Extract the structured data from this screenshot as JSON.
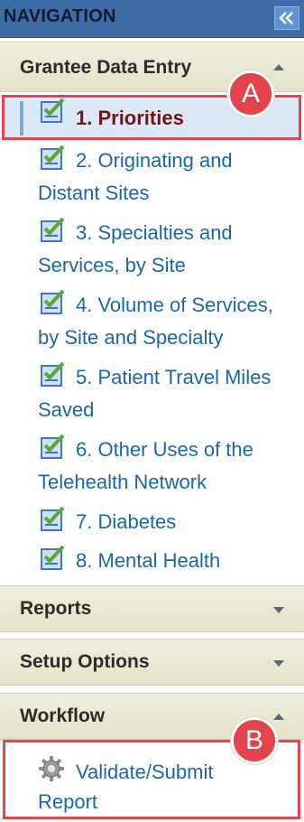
{
  "nav": {
    "title": "NAVIGATION",
    "collapse_icon": "double-chevron-left-icon"
  },
  "sections": {
    "grantee": {
      "label": "Grantee Data Entry",
      "state": "expanded"
    },
    "reports": {
      "label": "Reports",
      "state": "collapsed"
    },
    "setup": {
      "label": "Setup Options",
      "state": "collapsed"
    },
    "workflow": {
      "label": "Workflow",
      "state": "expanded"
    }
  },
  "grantee_items": [
    {
      "line1": "1. Priorities",
      "line2": "",
      "selected": true
    },
    {
      "line1": "2. Originating and",
      "line2": "Distant Sites"
    },
    {
      "line1": "3. Specialties and",
      "line2": "Services, by Site"
    },
    {
      "line1": "4. Volume of Services,",
      "line2": "by Site and Specialty"
    },
    {
      "line1": "5. Patient Travel Miles",
      "line2": "Saved"
    },
    {
      "line1": "6. Other Uses of the",
      "line2": "Telehealth Network"
    },
    {
      "line1": "7. Diabetes",
      "line2": ""
    },
    {
      "line1": "8. Mental Health",
      "line2": ""
    }
  ],
  "workflow_item": {
    "line1": "Validate/Submit",
    "line2": "Report",
    "icon": "gear-icon"
  },
  "annotations": {
    "a": "A",
    "b": "B"
  },
  "colors": {
    "header_bg": "#3d6ca6",
    "link": "#1a66ad",
    "selected_text": "#7a1212",
    "highlight_border": "#e5444e"
  }
}
